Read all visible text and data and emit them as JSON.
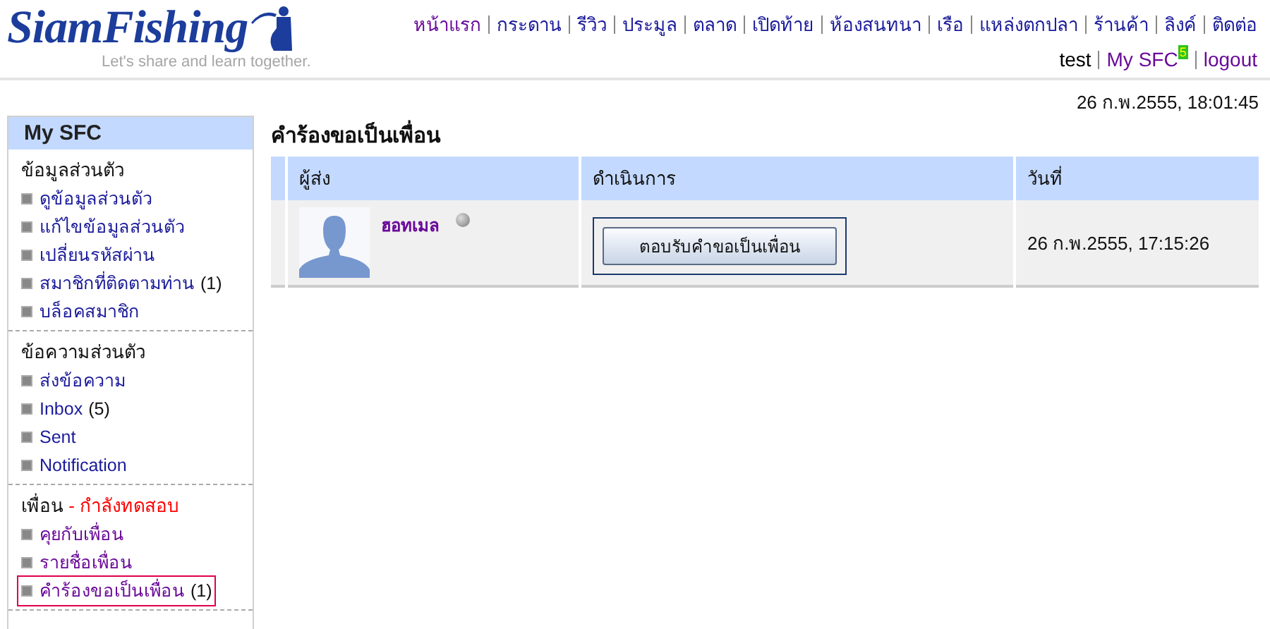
{
  "header": {
    "logo": {
      "name": "SiamFishing",
      "tagline": "Let's share and learn together."
    },
    "nav": [
      {
        "label": "หน้าแรก",
        "visited": true
      },
      {
        "label": "กระดาน",
        "visited": false
      },
      {
        "label": "รีวิว",
        "visited": false
      },
      {
        "label": "ประมูล",
        "visited": false
      },
      {
        "label": "ตลาด",
        "visited": false
      },
      {
        "label": "เปิดท้าย",
        "visited": false
      },
      {
        "label": "ห้องสนทนา",
        "visited": false
      },
      {
        "label": "เรือ",
        "visited": false
      },
      {
        "label": "แหล่งตกปลา",
        "visited": false
      },
      {
        "label": "ร้านค้า",
        "visited": false
      },
      {
        "label": "ลิงค์",
        "visited": false
      },
      {
        "label": "ติดต่อ",
        "visited": false
      }
    ],
    "user": {
      "name": "test",
      "my_sfc": "My SFC",
      "badge": "5",
      "logout": "logout"
    }
  },
  "sidebar": {
    "title": "My SFC",
    "sections": [
      {
        "heading": "ข้อมูลส่วนตัว",
        "items": [
          {
            "label": "ดูข้อมูลส่วนตัว",
            "visited": false,
            "selected": false
          },
          {
            "label": "แก้ไขข้อมูลส่วนตัว",
            "visited": false,
            "selected": false
          },
          {
            "label": "เปลี่ยนรหัสผ่าน",
            "visited": false,
            "selected": false
          },
          {
            "label": "สมาชิกที่ติดตามท่าน",
            "count": "(1)",
            "visited": false,
            "selected": false
          },
          {
            "label": "บล็อคสมาชิก",
            "visited": false,
            "selected": false
          }
        ]
      },
      {
        "heading": "ข้อความส่วนตัว",
        "items": [
          {
            "label": "ส่งข้อความ",
            "visited": false,
            "selected": false
          },
          {
            "label": "Inbox",
            "count": "(5)",
            "visited": false,
            "selected": false
          },
          {
            "label": "Sent",
            "visited": false,
            "selected": false
          },
          {
            "label": "Notification",
            "visited": false,
            "selected": false
          }
        ]
      },
      {
        "heading": "เพื่อน",
        "note": "- กำลังทดสอบ",
        "items": [
          {
            "label": "คุยกับเพื่อน",
            "visited": true,
            "selected": false
          },
          {
            "label": "รายชื่อเพื่อน",
            "visited": true,
            "selected": false
          },
          {
            "label": "คำร้องขอเป็นเพื่อน",
            "count": "(1)",
            "visited": true,
            "selected": true
          }
        ]
      }
    ]
  },
  "main": {
    "datetime": "26 ก.พ.2555, 18:01:45",
    "title": "คำร้องขอเป็นเพื่อน",
    "table": {
      "columns": [
        "ผู้ส่ง",
        "ดำเนินการ",
        "วันที่"
      ],
      "rows": [
        {
          "sender": "ฮอทเมล",
          "action": "ตอบรับคำขอเป็นเพื่อน",
          "date": "26 ก.พ.2555, 17:15:26"
        }
      ]
    }
  }
}
